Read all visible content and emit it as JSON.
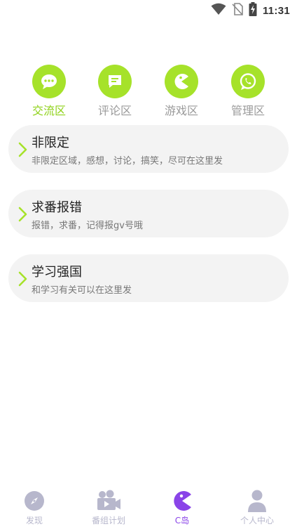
{
  "status": {
    "time": "11:31"
  },
  "categories": [
    {
      "label": "交流区",
      "icon": "chat-bubble-icon",
      "active": true
    },
    {
      "label": "评论区",
      "icon": "comment-icon",
      "active": false
    },
    {
      "label": "游戏区",
      "icon": "pacman-icon",
      "active": false
    },
    {
      "label": "管理区",
      "icon": "whatsapp-icon",
      "active": false
    }
  ],
  "boards": [
    {
      "title": "非限定",
      "desc": "非限定区域，感想，讨论，搞笑，尽可在这里发"
    },
    {
      "title": "求番报错",
      "desc": "报错，求番，记得报gv号哦"
    },
    {
      "title": "学习强国",
      "desc": "和学习有关可以在这里发"
    }
  ],
  "nav": [
    {
      "label": "发现",
      "icon": "compass-icon"
    },
    {
      "label": "番组计划",
      "icon": "video-camera-icon"
    },
    {
      "label": "C岛",
      "icon": "pacman-icon"
    },
    {
      "label": "个人中心",
      "icon": "person-icon"
    }
  ],
  "colors": {
    "accent_green": "#a6e22a",
    "active_label_green": "#8fd219",
    "nav_active_purple": "#8a44e8",
    "nav_inactive": "#b7b7cc",
    "card_bg": "#f3f3f3"
  }
}
